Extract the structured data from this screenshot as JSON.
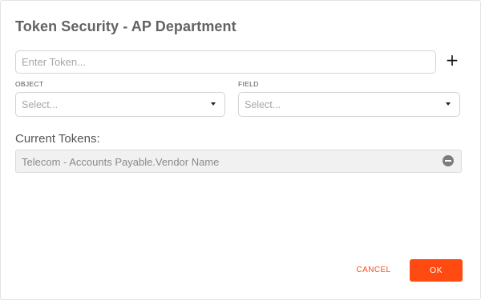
{
  "dialog": {
    "title": "Token Security - AP Department"
  },
  "token_entry": {
    "placeholder": "Enter Token...",
    "value": "",
    "add_label": "+"
  },
  "object_select": {
    "label": "OBJECT",
    "selected": "Select..."
  },
  "field_select": {
    "label": "FIELD",
    "selected": "Select..."
  },
  "current_tokens": {
    "heading": "Current Tokens:",
    "items": [
      {
        "label": "Telecom - Accounts Payable.Vendor Name",
        "remove_icon": "minus-circle-icon"
      }
    ]
  },
  "footer": {
    "cancel_label": "CANCEL",
    "ok_label": "OK"
  },
  "colors": {
    "accent": "#ff4a12",
    "title": "#636363",
    "token_row_bg": "#f1f1f1"
  }
}
